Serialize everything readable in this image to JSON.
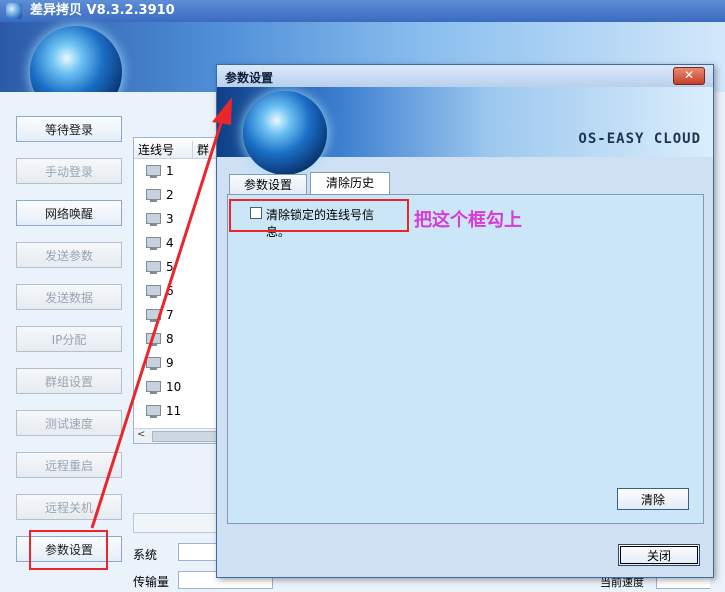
{
  "main_window": {
    "title": "差异拷贝 V8.3.2.3910",
    "list": {
      "col_conn": "连线号",
      "col_group": "群",
      "rows": [
        "1",
        "2",
        "3",
        "4",
        "5",
        "6",
        "7",
        "8",
        "9",
        "10",
        "11"
      ]
    },
    "side_buttons": [
      {
        "label": "等待登录",
        "enabled": true
      },
      {
        "label": "手动登录",
        "enabled": false
      },
      {
        "label": "网络唤醒",
        "enabled": true
      },
      {
        "label": "发送参数",
        "enabled": false
      },
      {
        "label": "发送数据",
        "enabled": false
      },
      {
        "label": "IP分配",
        "enabled": false
      },
      {
        "label": "群组设置",
        "enabled": false
      },
      {
        "label": "测试速度",
        "enabled": false
      },
      {
        "label": "远程重启",
        "enabled": false
      },
      {
        "label": "远程关机",
        "enabled": false
      },
      {
        "label": "参数设置",
        "enabled": true
      }
    ],
    "bottom": {
      "system_label": "系统",
      "transfer_label": "传输量",
      "speed_label": "当前速度"
    }
  },
  "dialog": {
    "title": "参数设置",
    "brand": "OS-EASY CLOUD",
    "tabs": [
      {
        "label": "参数设置",
        "active": false
      },
      {
        "label": "清除历史",
        "active": true
      }
    ],
    "checkbox_label": "清除锁定的连线号信息。",
    "checkbox_checked": false,
    "clear_button": "清除",
    "close_button": "关闭"
  },
  "annotation": {
    "text": "把这个框勾上"
  }
}
